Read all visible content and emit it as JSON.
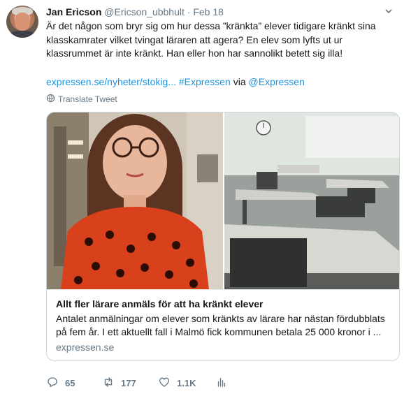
{
  "tweet": {
    "author_name": "Jan Ericson",
    "handle": "@Ericson_ubbhult",
    "separator": "·",
    "date": "Feb 18",
    "text": "Är det någon som bryr sig om hur dessa ”kränkta” elever tidigare kränkt sina klasskamrater vilket tvingat läraren att agera? En elev som lyfts ut ur klassrummet är inte kränkt. Han eller hon har sannolikt betett sig illa!",
    "link_url": "expressen.se/nyheter/stokig...",
    "hashtag": "#Expressen",
    "via_label": "via",
    "mention": "@Expressen",
    "translate_label": "Translate Tweet"
  },
  "card": {
    "title": "Allt fler lärare anmäls för att ha kränkt elever",
    "description": "Antalet anmälningar om elever som kränkts av lärare har nästan fördubblats på fem år. I ett aktuellt fall i Malmö fick kommunen betala 25 000 kronor i ...",
    "domain": "expressen.se"
  },
  "actions": {
    "reply_count": "65",
    "retweet_count": "177",
    "like_count": "1.1K"
  },
  "colors": {
    "link": "#1b95e0",
    "secondary_text": "#657786",
    "border": "#ccd6dd"
  },
  "icons": [
    "chevron-down-icon",
    "globe-icon",
    "reply-icon",
    "retweet-icon",
    "heart-icon",
    "analytics-icon"
  ]
}
